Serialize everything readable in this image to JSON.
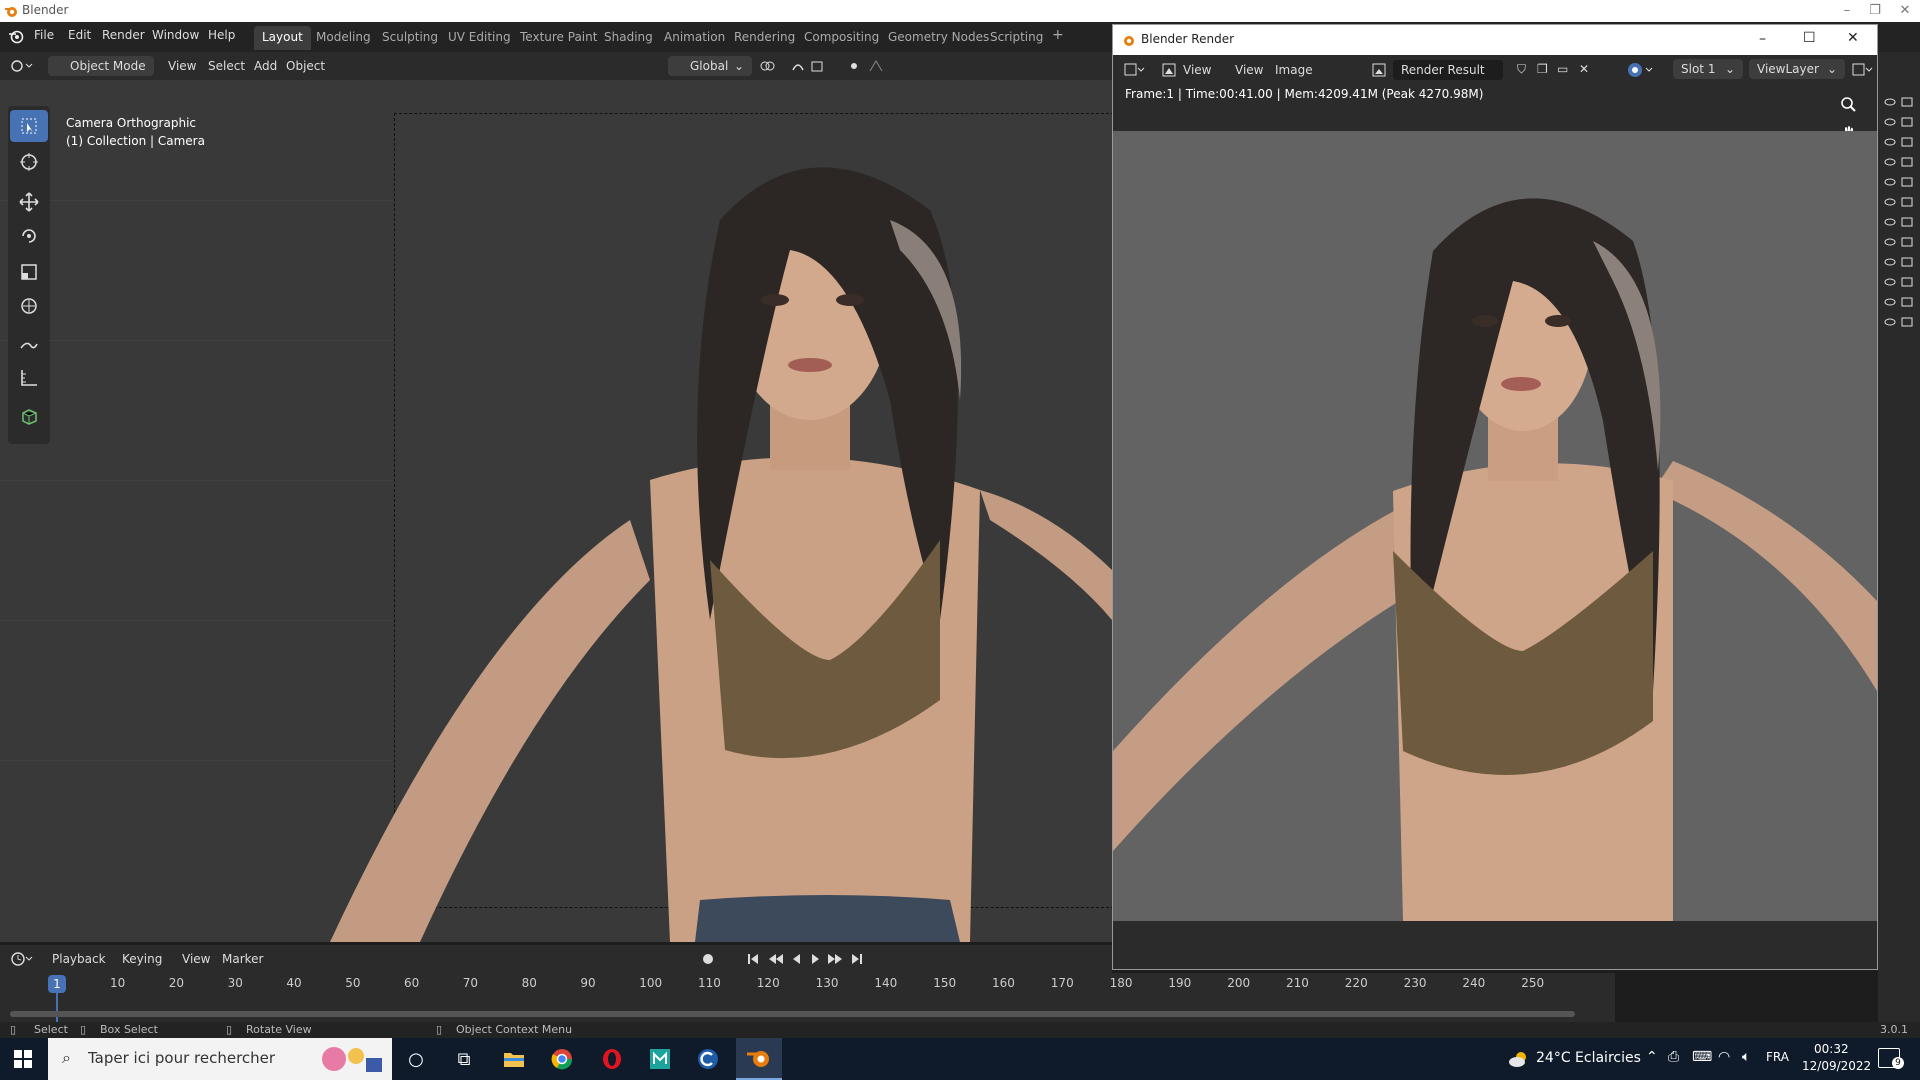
{
  "window": {
    "app_title": "Blender"
  },
  "topbar": {
    "menus": [
      "File",
      "Edit",
      "Render",
      "Window",
      "Help"
    ],
    "workspaces": [
      "Layout",
      "Modeling",
      "Sculpting",
      "UV Editing",
      "Texture Paint",
      "Shading",
      "Animation",
      "Rendering",
      "Compositing",
      "Geometry Nodes",
      "Scripting"
    ],
    "active_workspace": "Layout",
    "add_workspace": "+"
  },
  "viewport_header": {
    "mode": "Object Mode",
    "menus": [
      "View",
      "Select",
      "Add",
      "Object"
    ],
    "orientation": "Global"
  },
  "viewport": {
    "camera_label": "Camera Orthographic",
    "collection_label": "(1) Collection | Camera"
  },
  "render_window": {
    "title": "Blender Render",
    "menus": [
      "View",
      "View",
      "Image"
    ],
    "image_name": "Render Result",
    "slot": "Slot 1",
    "view_layer": "ViewLayer",
    "info": "Frame:1 | Time:00:41.00 | Mem:4209.41M (Peak 4270.98M)"
  },
  "timeline": {
    "menus": [
      "Playback",
      "Keying",
      "View",
      "Marker"
    ],
    "current_frame": "1",
    "frames": [
      "10",
      "20",
      "30",
      "40",
      "50",
      "60",
      "70",
      "80",
      "90",
      "100",
      "110",
      "120",
      "130",
      "140",
      "150",
      "160",
      "170",
      "180",
      "190",
      "200",
      "210",
      "220",
      "230",
      "240",
      "250"
    ]
  },
  "statusbar": {
    "select": "Select",
    "box_select": "Box Select",
    "rotate_view": "Rotate View",
    "context_menu": "Object Context Menu",
    "version": "3.0.1"
  },
  "taskbar": {
    "search_placeholder": "Taper ici pour rechercher",
    "weather": "24°C  Eclaircies",
    "language": "FRA",
    "time": "00:32",
    "date": "12/09/2022",
    "notifications": "9"
  },
  "colors": {
    "accent": "#4772b3",
    "skin": "#c89a7a",
    "hair": "#2a2522",
    "top": "#6e5b3f"
  }
}
